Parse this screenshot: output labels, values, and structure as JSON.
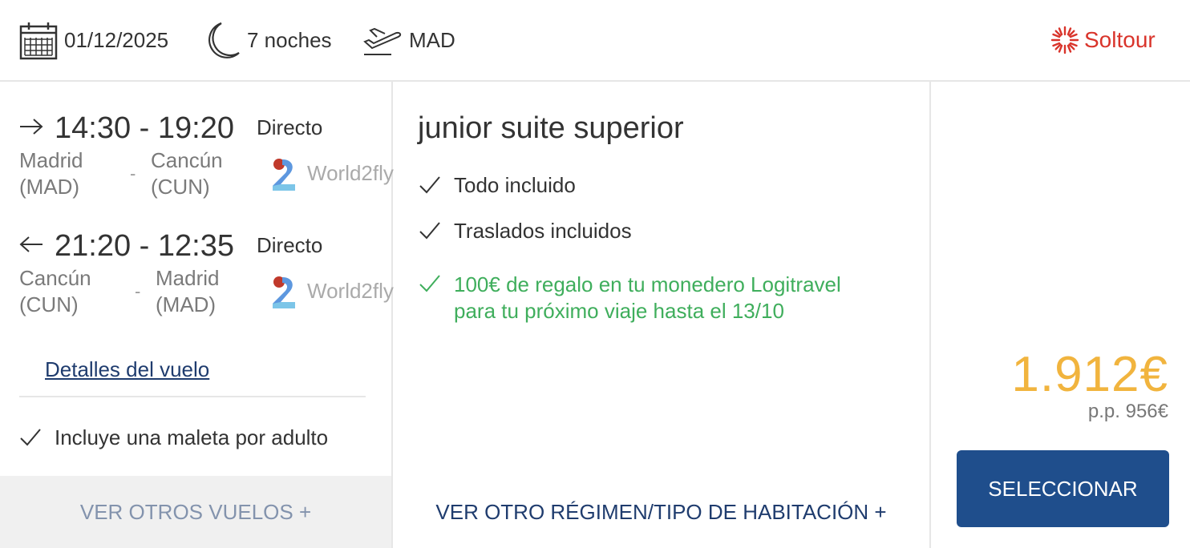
{
  "header": {
    "date": "01/12/2025",
    "nights": "7 noches",
    "origin": "MAD",
    "brand": "Soltour"
  },
  "flights": {
    "outbound": {
      "times": "14:30 - 19:20",
      "type": "Directo",
      "from_city": "Madrid",
      "from_code": "(MAD)",
      "to_city": "Cancún",
      "to_code": "(CUN)",
      "separator": "-",
      "airline": "World2fly"
    },
    "inbound": {
      "times": "21:20 - 12:35",
      "type": "Directo",
      "from_city": "Cancún",
      "from_code": "(CUN)",
      "to_city": "Madrid",
      "to_code": "(MAD)",
      "separator": "-",
      "airline": "World2fly"
    },
    "details_link": "Detalles del vuelo",
    "luggage": "Incluye una maleta por adulto",
    "other_flights": "VER OTROS VUELOS +"
  },
  "room": {
    "title": "junior suite superior",
    "features": [
      "Todo incluido",
      "Traslados incluidos"
    ],
    "promo_line1": "100€ de regalo en tu monedero Logitravel",
    "promo_line2": "para tu próximo viaje hasta el 13/10",
    "other_regime": "VER OTRO RÉGIMEN/TIPO DE HABITACIÓN +"
  },
  "pricing": {
    "total": "1.912€",
    "per_person": "p.p. 956€",
    "select_label": "SELECCIONAR"
  },
  "colors": {
    "brand_red": "#d9342b",
    "price_gold": "#f1b43e",
    "button_blue": "#1f4e8c",
    "promo_green": "#3fae5c",
    "link_navy": "#1f3c6e"
  }
}
